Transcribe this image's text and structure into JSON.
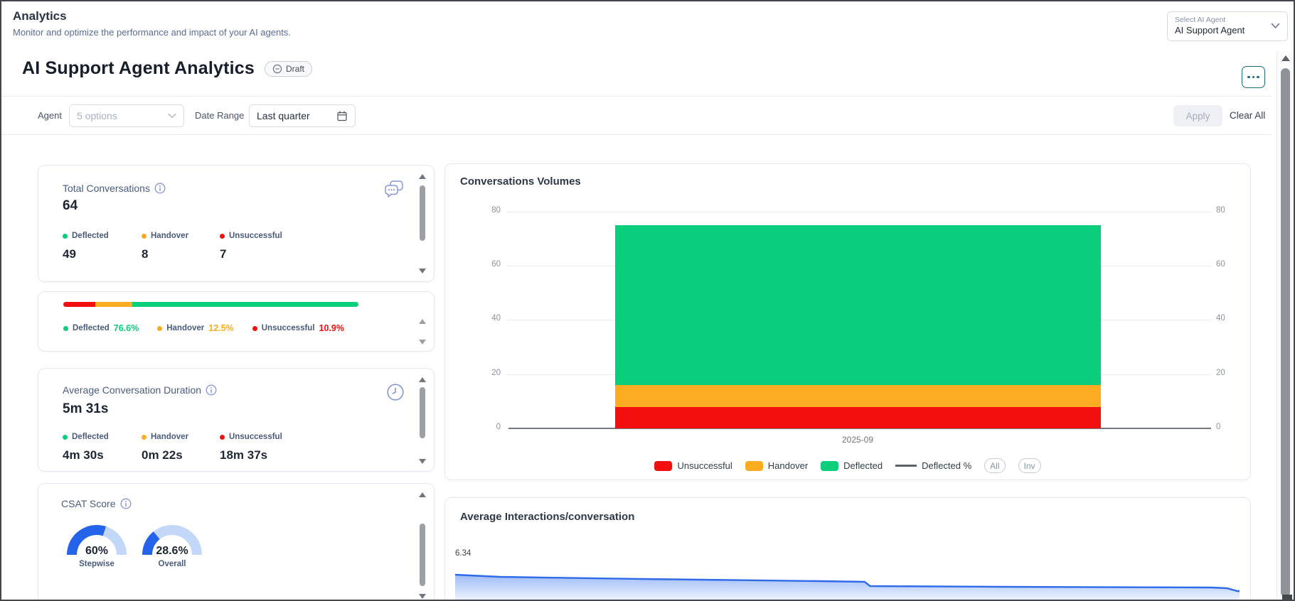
{
  "colors": {
    "green": "#0ACE7C",
    "orange": "#FBAC20",
    "red": "#F40F0F",
    "gauge_fill": "#2563EB",
    "gauge_track": "#C3D7F8",
    "line_blue": "#2F6AE8",
    "accent_teal": "#1D6A7C"
  },
  "header": {
    "title": "Analytics",
    "subtitle": "Monitor and optimize the performance and impact of your AI agents.",
    "agent_select": {
      "label": "Select AI Agent",
      "value": "AI Support Agent"
    }
  },
  "page": {
    "title": "AI Support Agent Analytics",
    "badge": "Draft"
  },
  "filters": {
    "agent_label": "Agent",
    "agent_value": "5 options",
    "date_label": "Date Range",
    "date_value": "Last quarter",
    "apply": "Apply",
    "clear": "Clear All"
  },
  "cards": {
    "total": {
      "title": "Total Conversations",
      "value": "64",
      "items": [
        {
          "label": "Deflected",
          "value": "49",
          "color": "#0ACE7C"
        },
        {
          "label": "Handover",
          "value": "8",
          "color": "#FBAC20"
        },
        {
          "label": "Unsuccessful",
          "value": "7",
          "color": "#F40F0F"
        }
      ]
    },
    "percent": {
      "segments": [
        {
          "name": "Unsuccessful",
          "pct": 10.9,
          "color": "#F40F0F"
        },
        {
          "name": "Handover",
          "pct": 12.5,
          "color": "#FBAC20"
        },
        {
          "name": "Deflected",
          "pct": 76.6,
          "color": "#0ACE7C"
        }
      ],
      "items": [
        {
          "label": "Deflected",
          "value": "76.6%",
          "color": "#0ACE7C"
        },
        {
          "label": "Handover",
          "value": "12.5%",
          "color": "#FBAC20"
        },
        {
          "label": "Unsuccessful",
          "value": "10.9%",
          "color": "#F40F0F"
        }
      ]
    },
    "duration": {
      "title": "Average Conversation Duration",
      "value": "5m 31s",
      "items": [
        {
          "label": "Deflected",
          "value": "4m 30s",
          "color": "#0ACE7C"
        },
        {
          "label": "Handover",
          "value": "0m 22s",
          "color": "#FBAC20"
        },
        {
          "label": "Unsuccessful",
          "value": "18m 37s",
          "color": "#F40F0F"
        }
      ]
    },
    "csat": {
      "title": "CSAT Score",
      "gauges": [
        {
          "value": "60%",
          "label": "Stepwise",
          "pct": 60
        },
        {
          "value": "28.6%",
          "label": "Overall",
          "pct": 28.6
        }
      ]
    }
  },
  "chart_data": [
    {
      "id": "conversations-volumes",
      "type": "bar",
      "stacked": true,
      "title": "Conversations Volumes",
      "categories": [
        "2025-09"
      ],
      "series": [
        {
          "name": "Unsuccessful",
          "values": [
            8
          ],
          "color": "#F40F0F"
        },
        {
          "name": "Handover",
          "values": [
            8
          ],
          "color": "#FBAC20"
        },
        {
          "name": "Deflected",
          "values": [
            59
          ],
          "color": "#0ACE7C"
        }
      ],
      "line_legend": {
        "name": "Deflected %",
        "color": "#5A6168"
      },
      "ylim": [
        0,
        80
      ],
      "yticks": [
        80,
        60,
        40,
        20,
        0
      ],
      "y2ticks": [
        80,
        60,
        40,
        20,
        0
      ],
      "grid": true,
      "legend_position": "bottom",
      "toggles": [
        "All",
        "Inv"
      ]
    },
    {
      "id": "avg-interactions",
      "type": "area",
      "title": "Average Interactions/conversation",
      "ylabel_tick": "6.34",
      "series": [
        {
          "name": "Average Interactions/conversation",
          "color": "#2F6AE8",
          "points_pct": [
            [
              0,
              20
            ],
            [
              5.7,
              26
            ],
            [
              23.8,
              32
            ],
            [
              46.5,
              38
            ],
            [
              52.2,
              40
            ],
            [
              52.9,
              52
            ],
            [
              69.2,
              54
            ],
            [
              96.4,
              56
            ],
            [
              98.4,
              58
            ],
            [
              99.7,
              66
            ],
            [
              100,
              66
            ]
          ]
        }
      ]
    }
  ]
}
